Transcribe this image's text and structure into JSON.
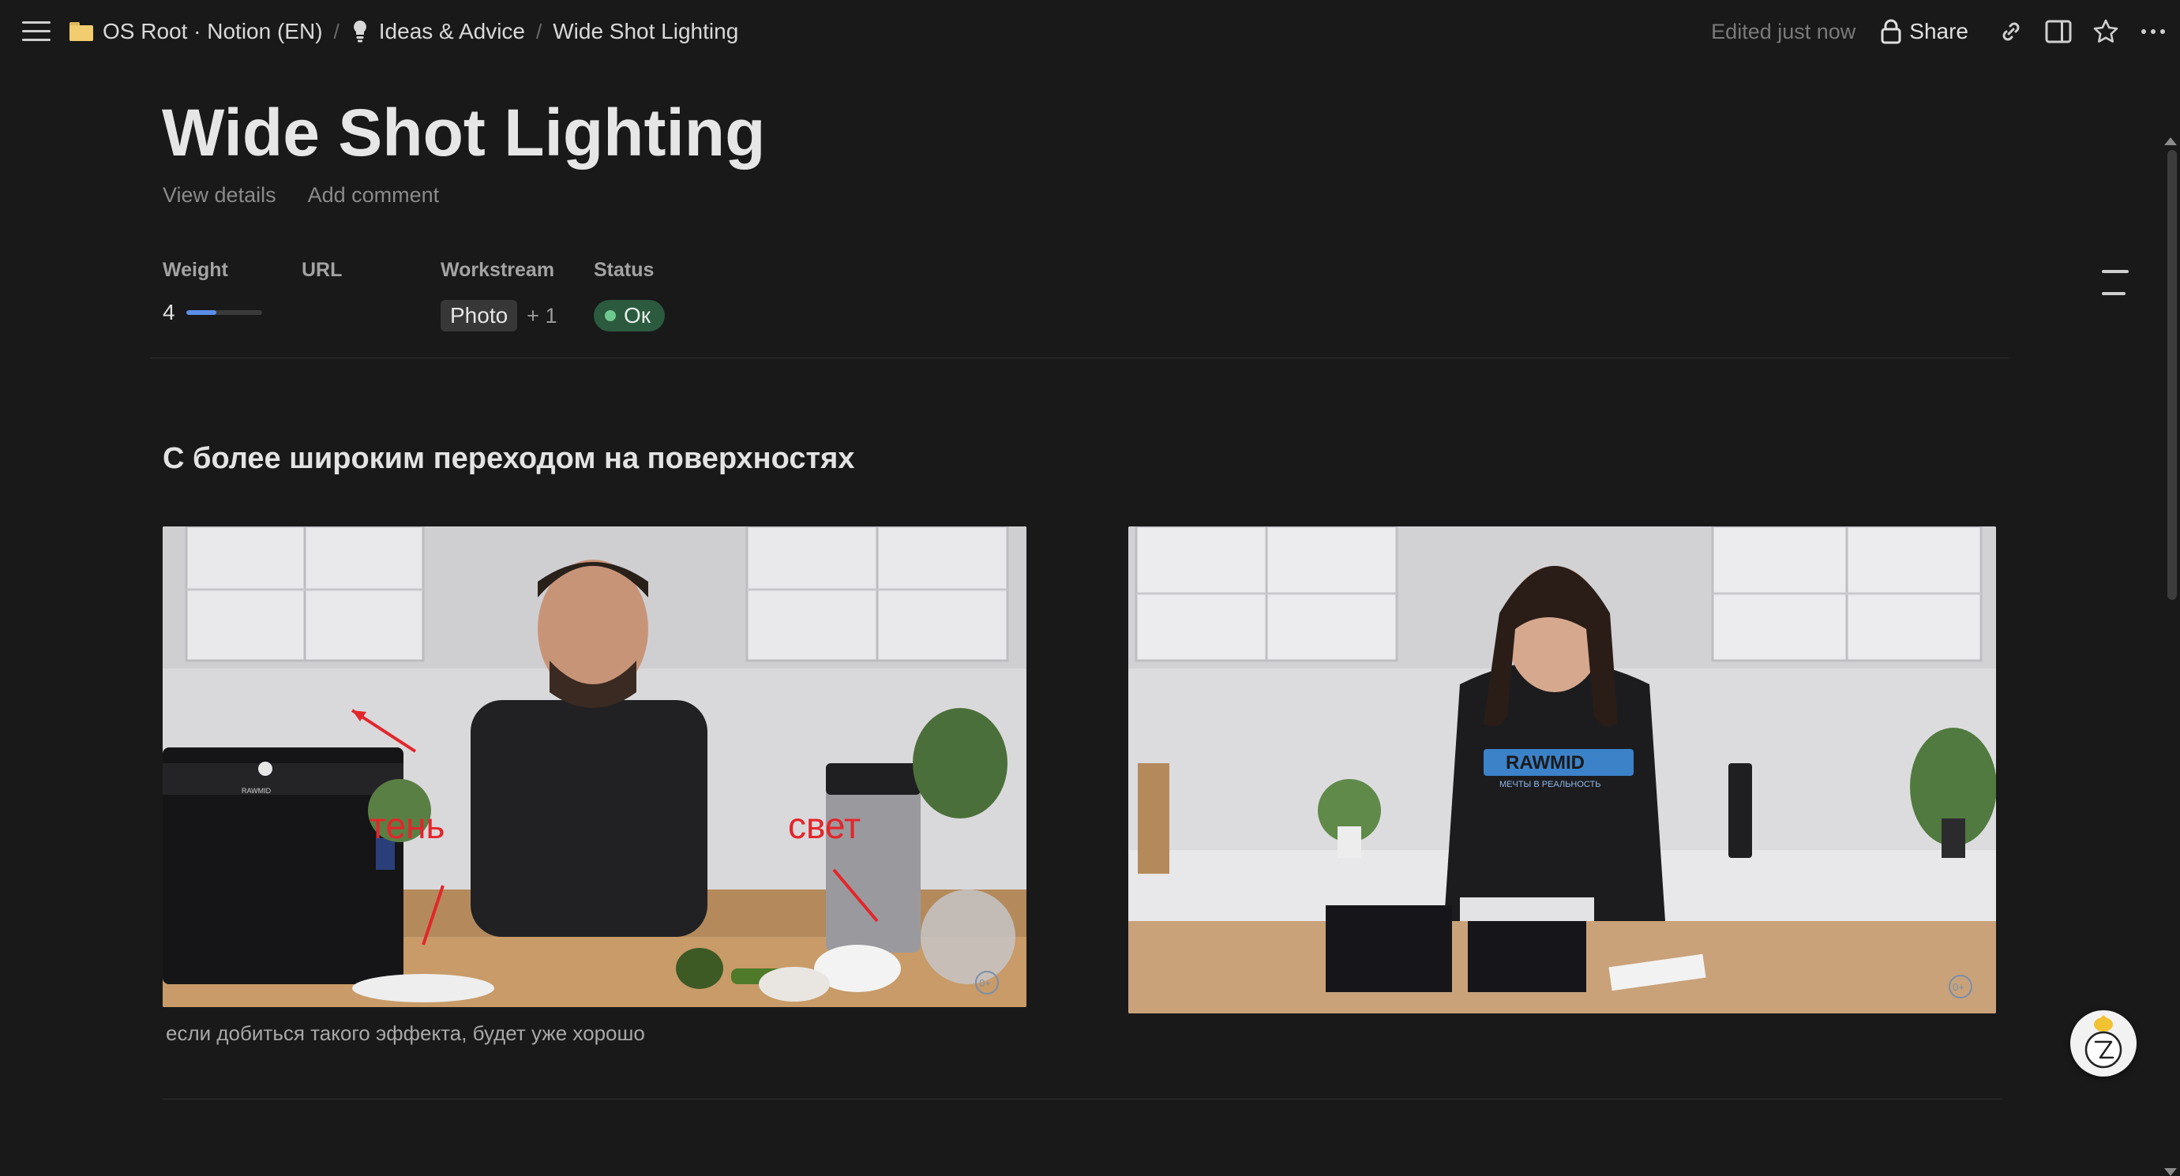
{
  "breadcrumb": {
    "items": [
      {
        "label": "OS Root · Notion (EN)"
      },
      {
        "label": "Ideas & Advice"
      },
      {
        "label": "Wide Shot Lighting"
      }
    ],
    "separator": "/"
  },
  "header": {
    "edited": "Edited just now",
    "share_label": "Share"
  },
  "page": {
    "title": "Wide Shot Lighting",
    "view_details": "View details",
    "add_comment": "Add comment"
  },
  "properties": {
    "weight": {
      "label": "Weight",
      "value": "4",
      "progress": 0.4
    },
    "url": {
      "label": "URL",
      "value": ""
    },
    "workstream": {
      "label": "Workstream",
      "tag": "Photo",
      "more": "+ 1"
    },
    "status": {
      "label": "Status",
      "value": "Ок",
      "color": "#2b5a3f"
    }
  },
  "content": {
    "heading": "С более широким переходом на поверхностях",
    "image1": {
      "annotation_shadow": "тень",
      "annotation_light": "свет",
      "brand": "RAWMID",
      "age_badge": "0+"
    },
    "image2": {
      "shirt_text": "RAWMID",
      "shirt_sub": "МЕЧТЫ В РЕАЛЬНОСТЬ",
      "age_badge": "0+"
    },
    "caption": "если добиться такого эффекта, будет уже хорошо"
  },
  "colors": {
    "background": "#191919",
    "accent_blue": "#5a8ee8",
    "status_green": "#6ec98e"
  }
}
